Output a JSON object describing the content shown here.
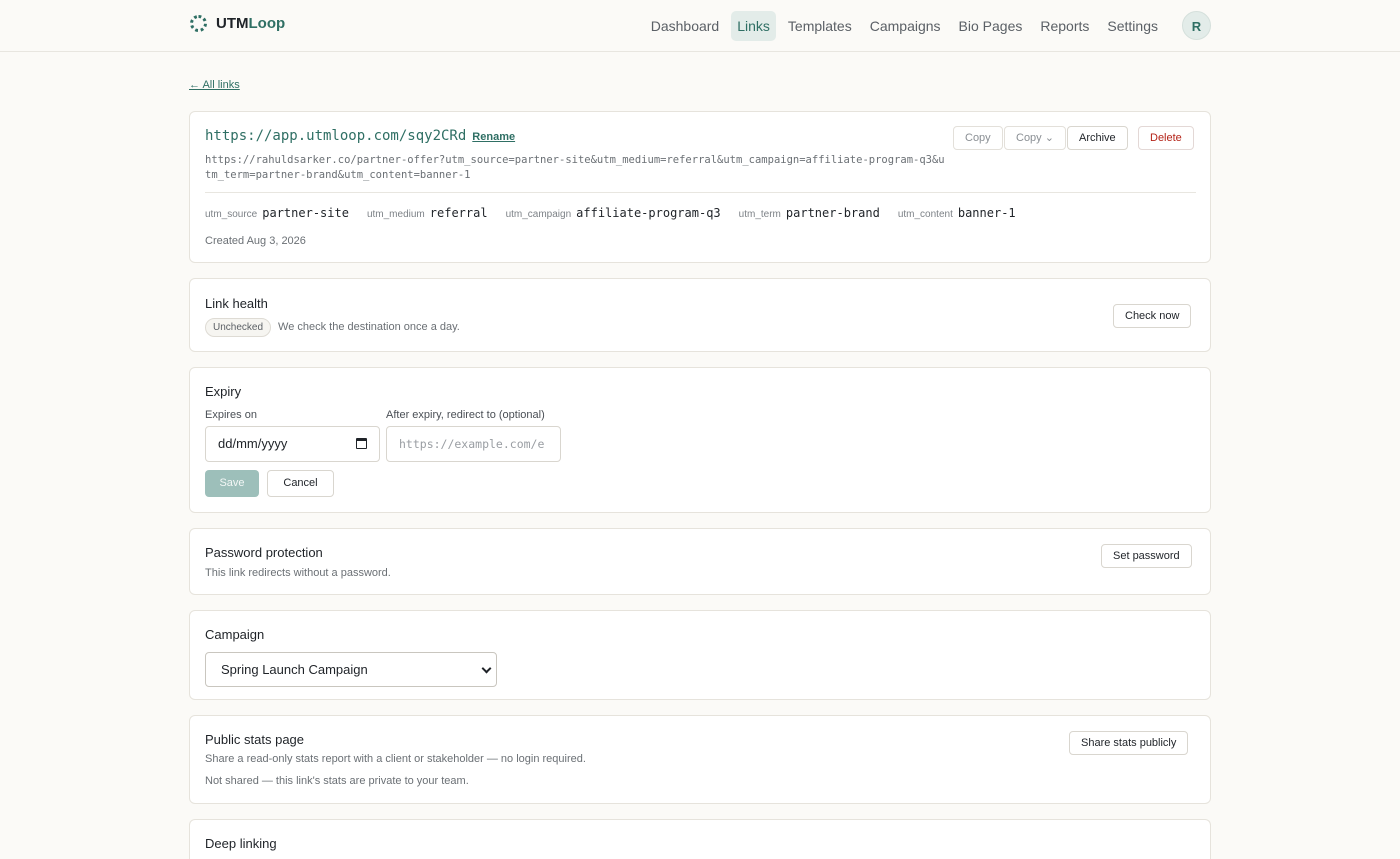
{
  "app": {
    "name_main": "UTM",
    "name_accent": "Loop",
    "avatar_initial": "R"
  },
  "nav": {
    "items": [
      "Dashboard",
      "Links",
      "Templates",
      "Campaigns",
      "Bio Pages",
      "Reports",
      "Settings"
    ],
    "active": "Links"
  },
  "back_link": "← All links",
  "link": {
    "short_url": "https://app.utmloop.com/sqy2CRd",
    "rename": "Rename",
    "long_url": "https://rahuldsarker.co/partner-offer?utm_source=partner-site&utm_medium=referral&utm_campaign=affiliate-program-q3&utm_term=partner-brand&utm_content=banner-1",
    "actions": {
      "copy": "Copy",
      "copy_menu": "Copy ⌄",
      "archive": "Archive",
      "delete": "Delete"
    },
    "params": [
      {
        "key": "utm_source",
        "value": "partner-site"
      },
      {
        "key": "utm_medium",
        "value": "referral"
      },
      {
        "key": "utm_campaign",
        "value": "affiliate-program-q3"
      },
      {
        "key": "utm_term",
        "value": "partner-brand"
      },
      {
        "key": "utm_content",
        "value": "banner-1"
      }
    ],
    "created": "Created Aug 3, 2026"
  },
  "health": {
    "title": "Link health",
    "status": "Unchecked",
    "note": "We check the destination once a day.",
    "button": "Check now"
  },
  "expiry": {
    "title": "Expiry",
    "expires_label": "Expires on",
    "expires_value": "dd/mm/yyyy",
    "redirect_label": "After expiry, redirect to (optional)",
    "redirect_placeholder": "https://example.com/e",
    "save": "Save",
    "cancel": "Cancel"
  },
  "password": {
    "title": "Password protection",
    "note": "This link redirects without a password.",
    "button": "Set password"
  },
  "campaign": {
    "title": "Campaign",
    "selected": "Spring Launch Campaign"
  },
  "public_stats": {
    "title": "Public stats page",
    "description": "Share a read-only stats report with a client or stakeholder — no login required.",
    "status": "Not shared — this link's stats are private to your team.",
    "button": "Share stats publicly"
  },
  "deep_linking": {
    "title": "Deep linking"
  }
}
